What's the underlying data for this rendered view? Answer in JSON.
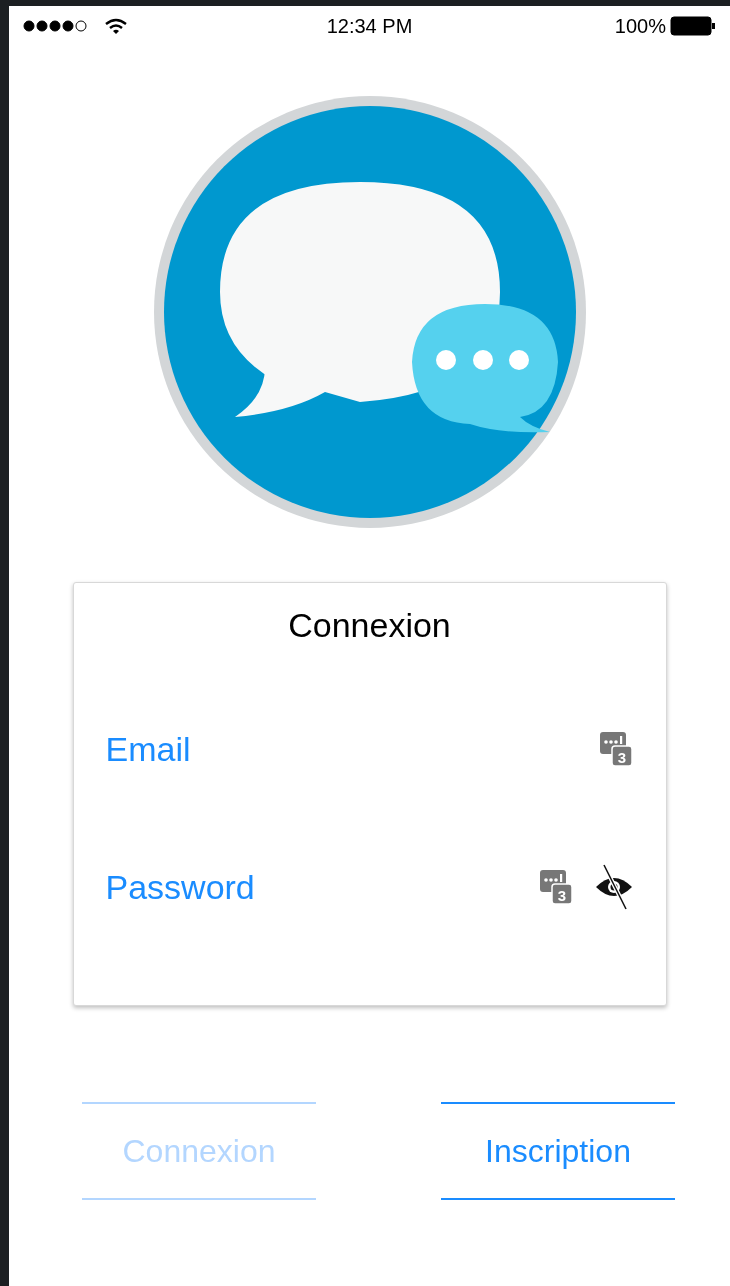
{
  "status_bar": {
    "time": "12:34 PM",
    "battery": "100%"
  },
  "login_card": {
    "title": "Connexion",
    "fields": [
      {
        "placeholder": "Email",
        "key_badge": "3",
        "password_toggle": false
      },
      {
        "placeholder": "Password",
        "key_badge": "3",
        "password_toggle": true
      }
    ]
  },
  "buttons": [
    {
      "label": "Connexion",
      "disabled": true
    },
    {
      "label": "Inscription",
      "disabled": false
    }
  ]
}
